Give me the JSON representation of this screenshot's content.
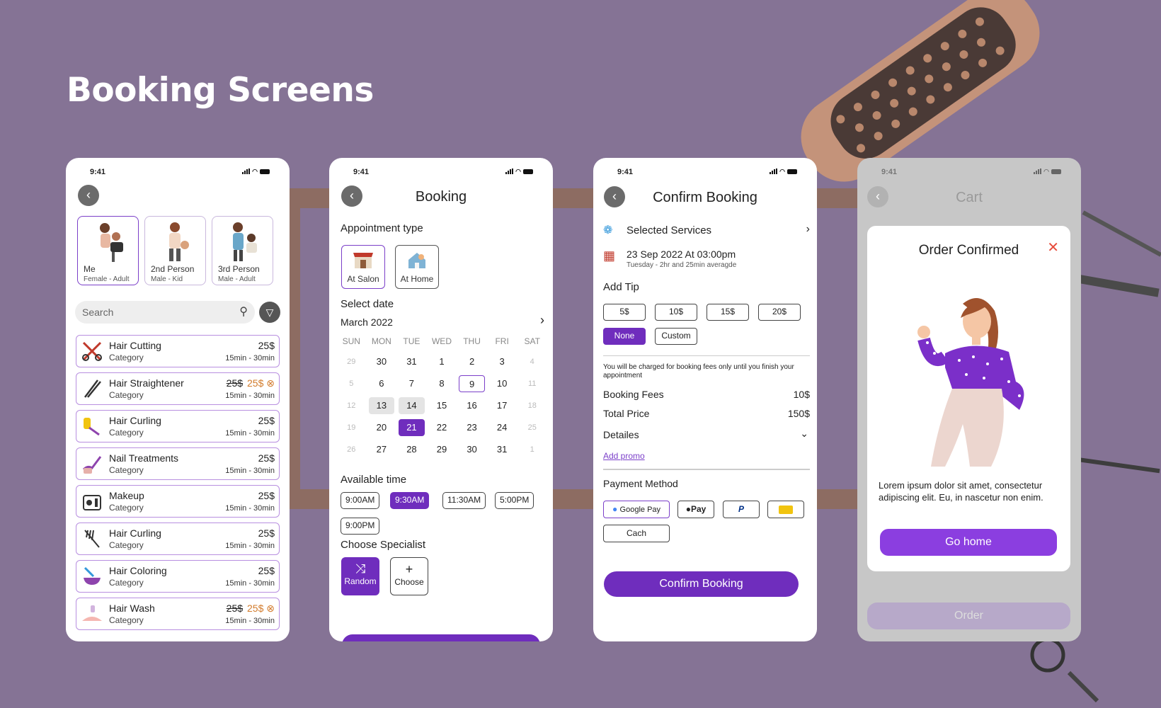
{
  "page_title": "Booking Screens",
  "status_time": "9:41",
  "screen1": {
    "persons": [
      {
        "name": "Me",
        "type": "Female - Adult"
      },
      {
        "name": "2nd Person",
        "type": "Male - Kid"
      },
      {
        "name": "3rd Person",
        "type": "Male - Adult"
      }
    ],
    "search_placeholder": "Search",
    "services": [
      {
        "name": "Hair Cutting",
        "category": "Category",
        "price": "25$",
        "old_price": "",
        "duration": "15min - 30min",
        "icon": "scissors-icon"
      },
      {
        "name": "Hair Straightener",
        "category": "Category",
        "price": "25$",
        "old_price": "25$",
        "duration": "15min - 30min",
        "icon": "straightener-icon"
      },
      {
        "name": "Hair Curling",
        "category": "Category",
        "price": "25$",
        "old_price": "",
        "duration": "15min - 30min",
        "icon": "curler-icon"
      },
      {
        "name": "Nail Treatments",
        "category": "Category",
        "price": "25$",
        "old_price": "",
        "duration": "15min - 30min",
        "icon": "nail-polish-icon"
      },
      {
        "name": "Makeup",
        "category": "Category",
        "price": "25$",
        "old_price": "",
        "duration": "15min - 30min",
        "icon": "makeup-icon"
      },
      {
        "name": "Hair Curling",
        "category": "Category",
        "price": "25$",
        "old_price": "",
        "duration": "15min - 30min",
        "icon": "comb-icon"
      },
      {
        "name": "Hair Coloring",
        "category": "Category",
        "price": "25$",
        "old_price": "",
        "duration": "15min - 30min",
        "icon": "dye-bowl-icon"
      },
      {
        "name": "Hair Wash",
        "category": "Category",
        "price": "25$",
        "old_price": "25$",
        "duration": "15min - 30min",
        "icon": "wash-icon"
      }
    ]
  },
  "screen2": {
    "title": "Booking",
    "appointment_type_label": "Appointment type",
    "types": [
      "At Salon",
      "At Home"
    ],
    "select_date_label": "Select date",
    "month": "March 2022",
    "weekdays": [
      "SUN",
      "MON",
      "TUE",
      "WED",
      "THU",
      "FRI",
      "SAT"
    ],
    "days": [
      "29",
      "30",
      "31",
      "1",
      "2",
      "3",
      "4",
      "5",
      "6",
      "7",
      "8",
      "9",
      "10",
      "11",
      "12",
      "13",
      "14",
      "15",
      "16",
      "17",
      "18",
      "19",
      "20",
      "21",
      "22",
      "23",
      "24",
      "25",
      "26",
      "27",
      "28",
      "29",
      "30",
      "31",
      "1"
    ],
    "available_time_label": "Available time",
    "times": [
      "9:00AM",
      "9:30AM",
      "11:30AM",
      "5:00PM",
      "9:00PM"
    ],
    "specialist_label": "Choose Specialist",
    "specialists": [
      "Random",
      "Choose"
    ]
  },
  "screen3": {
    "title": "Confirm Booking",
    "selected_services": "Selected Services",
    "date": "23 Sep 2022 At 03:00pm",
    "date_sub": "Tuesday - 2hr and 25min averagde",
    "add_tip": "Add Tip",
    "tips": [
      "5$",
      "10$",
      "15$",
      "20$",
      "None",
      "Custom"
    ],
    "fee_note": "You will be charged for booking fees only until you finish your appointment",
    "booking_fees_label": "Booking Fees",
    "booking_fees": "10$",
    "total_label": "Total Price",
    "total": "150$",
    "details": "Detailes",
    "promo": "Add promo",
    "payment_label": "Payment Method",
    "payments": [
      "Google Pay",
      "Pay",
      "",
      "",
      "Cach"
    ],
    "confirm": "Confirm Booking"
  },
  "screen4": {
    "title": "Cart",
    "modal_title": "Order Confirmed",
    "message": "Lorem ipsum dolor sit amet, consectetur adipiscing elit. Eu, in nascetur non enim.",
    "go_home": "Go home",
    "order": "Order"
  },
  "colors": {
    "background": "#857395",
    "accent": "#6f2dbd",
    "button": "#8b3ee0"
  }
}
